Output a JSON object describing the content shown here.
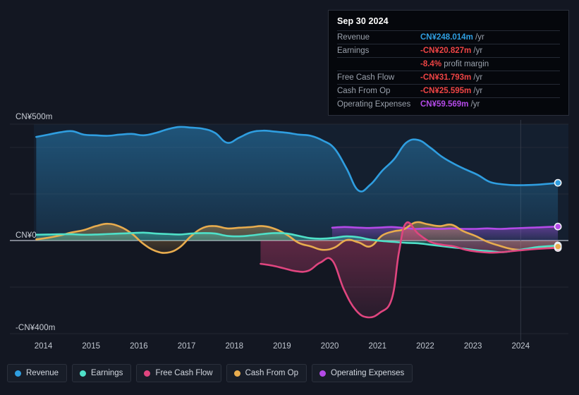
{
  "colors": {
    "revenue": "#2f9ee0",
    "earnings": "#4fe0c8",
    "free_cash_flow": "#e0457f",
    "cash_from_op": "#e8ac4e",
    "operating_expenses": "#b44ae8",
    "background": "#131722",
    "tooltip_bg": "#05070c",
    "negative": "#ef4444",
    "gridline": "#2a2f3b"
  },
  "tooltip": {
    "date": "Sep 30 2024",
    "rows": [
      {
        "label": "Revenue",
        "value": "CN¥248.014m",
        "unit": "/yr",
        "color": "#2f9ee0"
      },
      {
        "label": "Earnings",
        "value": "-CN¥20.827m",
        "unit": "/yr",
        "color": "#ef4444"
      },
      {
        "label": "",
        "value": "-8.4%",
        "unit": "profit margin",
        "color": "#ef4444"
      },
      {
        "label": "Free Cash Flow",
        "value": "-CN¥31.793m",
        "unit": "/yr",
        "color": "#ef4444"
      },
      {
        "label": "Cash From Op",
        "value": "-CN¥25.595m",
        "unit": "/yr",
        "color": "#ef4444"
      },
      {
        "label": "Operating Expenses",
        "value": "CN¥59.569m",
        "unit": "/yr",
        "color": "#b44ae8"
      }
    ]
  },
  "legend": {
    "items": [
      {
        "label": "Revenue",
        "color": "#2f9ee0"
      },
      {
        "label": "Earnings",
        "color": "#4fe0c8"
      },
      {
        "label": "Free Cash Flow",
        "color": "#e0457f"
      },
      {
        "label": "Cash From Op",
        "color": "#e8ac4e"
      },
      {
        "label": "Operating Expenses",
        "color": "#b44ae8"
      }
    ]
  },
  "axis": {
    "y_labels": [
      {
        "text": "CN¥500m",
        "value": 500
      },
      {
        "text": "CN¥0",
        "value": 0
      },
      {
        "text": "-CN¥400m",
        "value": -400
      }
    ],
    "x_labels": [
      "2014",
      "2015",
      "2016",
      "2017",
      "2018",
      "2019",
      "2020",
      "2021",
      "2022",
      "2023",
      "2024"
    ]
  },
  "chart_data": {
    "type": "area",
    "title": "",
    "xlabel": "",
    "ylabel": "CN¥",
    "ylim": [
      -430,
      520
    ],
    "xlim": [
      2013.8,
      2025.0
    ],
    "grid": true,
    "legend_position": "bottom",
    "y_gridlines": [
      500,
      400,
      200,
      0,
      -200,
      -400
    ],
    "forecast_divider_x": 2024.0,
    "series": [
      {
        "name": "Revenue",
        "color": "#2f9ee0",
        "x": [
          2013.85,
          2014.1,
          2014.35,
          2014.6,
          2014.85,
          2015.1,
          2015.35,
          2015.6,
          2015.85,
          2016.1,
          2016.35,
          2016.6,
          2016.85,
          2017.1,
          2017.35,
          2017.6,
          2017.85,
          2018.1,
          2018.35,
          2018.6,
          2018.85,
          2019.1,
          2019.35,
          2019.6,
          2019.85,
          2020.1,
          2020.35,
          2020.6,
          2020.85,
          2021.1,
          2021.35,
          2021.6,
          2021.85,
          2022.1,
          2022.35,
          2022.6,
          2022.85,
          2023.1,
          2023.35,
          2023.6,
          2023.85,
          2024.1,
          2024.35,
          2024.6,
          2024.78
        ],
        "values": [
          445,
          455,
          465,
          470,
          455,
          452,
          450,
          455,
          458,
          452,
          462,
          478,
          488,
          485,
          480,
          462,
          420,
          442,
          465,
          472,
          468,
          463,
          455,
          450,
          430,
          395,
          310,
          215,
          240,
          300,
          350,
          420,
          432,
          400,
          360,
          330,
          305,
          282,
          252,
          242,
          238,
          238,
          240,
          244,
          248
        ]
      },
      {
        "name": "Earnings",
        "color": "#4fe0c8",
        "x": [
          2013.85,
          2014.1,
          2014.35,
          2014.6,
          2014.85,
          2015.1,
          2015.35,
          2015.6,
          2015.85,
          2016.1,
          2016.35,
          2016.6,
          2016.85,
          2017.1,
          2017.35,
          2017.6,
          2017.85,
          2018.1,
          2018.35,
          2018.6,
          2018.85,
          2019.1,
          2019.35,
          2019.6,
          2019.85,
          2020.1,
          2020.35,
          2020.6,
          2020.85,
          2021.1,
          2021.35,
          2021.6,
          2021.85,
          2022.1,
          2022.35,
          2022.6,
          2022.85,
          2023.1,
          2023.35,
          2023.6,
          2023.85,
          2024.1,
          2024.35,
          2024.6,
          2024.78
        ],
        "values": [
          25,
          26,
          27,
          27,
          25,
          26,
          28,
          30,
          32,
          34,
          30,
          28,
          26,
          30,
          32,
          30,
          20,
          18,
          22,
          28,
          32,
          30,
          20,
          10,
          8,
          12,
          18,
          14,
          4,
          -2,
          -6,
          -10,
          -12,
          -18,
          -24,
          -30,
          -36,
          -42,
          -46,
          -50,
          -44,
          -36,
          -28,
          -24,
          -21
        ]
      },
      {
        "name": "Free Cash Flow",
        "color": "#e0457f",
        "x": [
          2018.55,
          2018.8,
          2019.05,
          2019.3,
          2019.55,
          2019.8,
          2020.05,
          2020.3,
          2020.55,
          2020.8,
          2021.05,
          2021.3,
          2021.45,
          2021.6,
          2021.85,
          2022.1,
          2022.35,
          2022.6,
          2022.85,
          2023.1,
          2023.35,
          2023.6,
          2023.85,
          2024.1,
          2024.35,
          2024.6,
          2024.78
        ],
        "values": [
          -100,
          -108,
          -120,
          -132,
          -130,
          -95,
          -85,
          -212,
          -300,
          -330,
          -310,
          -250,
          -50,
          75,
          30,
          -5,
          -18,
          -25,
          -40,
          -48,
          -52,
          -50,
          -45,
          -40,
          -36,
          -33,
          -32
        ]
      },
      {
        "name": "Cash From Op",
        "color": "#e8ac4e",
        "x": [
          2013.85,
          2014.1,
          2014.35,
          2014.6,
          2014.85,
          2015.1,
          2015.35,
          2015.6,
          2015.85,
          2016.1,
          2016.35,
          2016.6,
          2016.85,
          2017.1,
          2017.35,
          2017.6,
          2017.85,
          2018.1,
          2018.35,
          2018.6,
          2018.85,
          2019.1,
          2019.35,
          2019.6,
          2019.85,
          2020.1,
          2020.35,
          2020.6,
          2020.85,
          2021.1,
          2021.35,
          2021.55,
          2021.8,
          2022.05,
          2022.3,
          2022.55,
          2022.8,
          2023.05,
          2023.3,
          2023.55,
          2023.8,
          2024.05,
          2024.3,
          2024.55,
          2024.78
        ],
        "values": [
          5,
          12,
          22,
          35,
          45,
          62,
          72,
          60,
          30,
          -15,
          -45,
          -52,
          -30,
          20,
          55,
          62,
          52,
          55,
          58,
          62,
          50,
          25,
          -10,
          -25,
          -40,
          -30,
          2,
          -8,
          -25,
          22,
          40,
          48,
          78,
          70,
          62,
          68,
          40,
          20,
          -5,
          -22,
          -36,
          -40,
          -32,
          -26,
          -26
        ]
      },
      {
        "name": "Operating Expenses",
        "color": "#b44ae8",
        "x": [
          2020.05,
          2020.3,
          2020.55,
          2020.8,
          2021.05,
          2021.3,
          2021.55,
          2021.8,
          2022.05,
          2022.3,
          2022.55,
          2022.8,
          2023.05,
          2023.3,
          2023.55,
          2023.8,
          2024.05,
          2024.3,
          2024.55,
          2024.78
        ],
        "values": [
          55,
          58,
          56,
          54,
          56,
          58,
          54,
          50,
          52,
          50,
          52,
          50,
          50,
          52,
          50,
          52,
          54,
          56,
          58,
          60
        ]
      }
    ]
  }
}
